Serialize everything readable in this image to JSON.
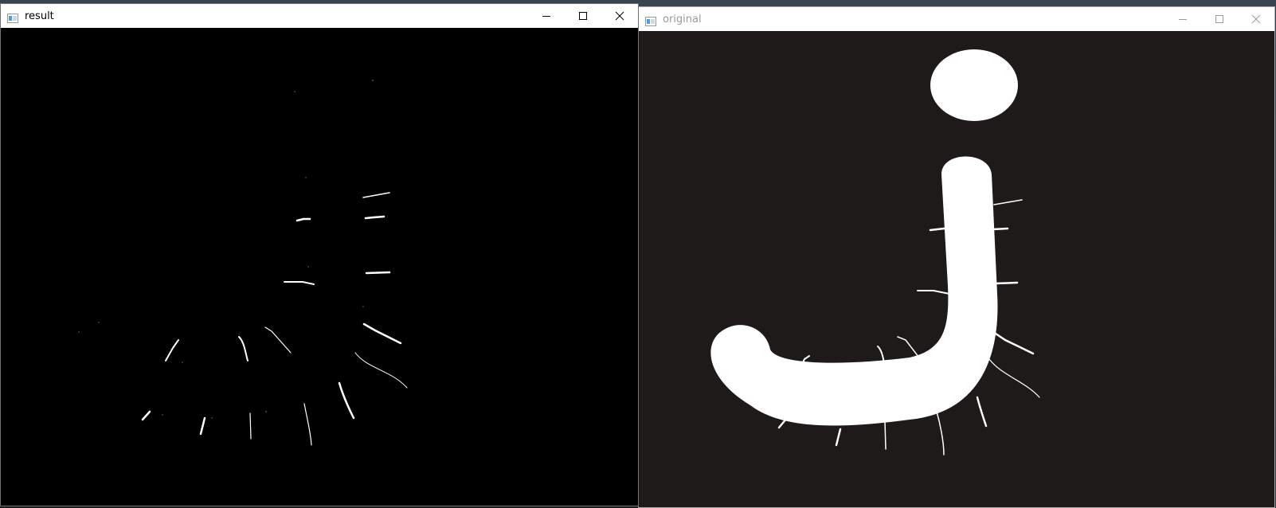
{
  "windows": {
    "result": {
      "title": "result",
      "icon": "app-window-icon",
      "controls": [
        "minimize-icon",
        "maximize-icon",
        "close-icon"
      ],
      "active": true
    },
    "original": {
      "title": "original",
      "icon": "app-window-icon",
      "controls": [
        "minimize-icon",
        "maximize-icon",
        "close-icon"
      ],
      "active": false
    }
  },
  "colors": {
    "result_background": "#000000",
    "original_background": "#1e1a19",
    "stroke": "#ffffff"
  }
}
